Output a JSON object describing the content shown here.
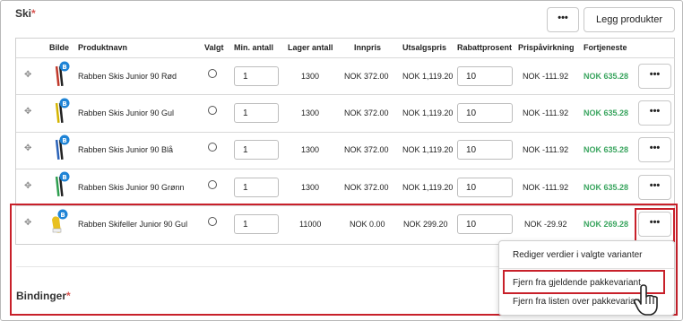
{
  "ski": {
    "title": "Ski",
    "required_mark": "*"
  },
  "bindings": {
    "title": "Bindinger",
    "required_mark": "*"
  },
  "toolbar": {
    "more_label": "•••",
    "add_products_label": "Legg produkter"
  },
  "table": {
    "headers": [
      "Bilde",
      "Produktnavn",
      "Valgt",
      "Min. antall",
      "Lager antall",
      "Innpris",
      "Utsalgspris",
      "Rabattprosent",
      "Prispåvirkning",
      "Fortjeneste"
    ],
    "rows": [
      {
        "name": "Rabben Skis Junior 90 Rød",
        "min_qty": "1",
        "stock": "1300",
        "cost": "NOK 372.00",
        "sale": "NOK 1,119.20",
        "discount": "10",
        "impact": "NOK -111.92",
        "profit": "NOK 635.28",
        "more": "•••"
      },
      {
        "name": "Rabben Skis Junior 90 Gul",
        "min_qty": "1",
        "stock": "1300",
        "cost": "NOK 372.00",
        "sale": "NOK 1,119.20",
        "discount": "10",
        "impact": "NOK -111.92",
        "profit": "NOK 635.28",
        "more": "•••"
      },
      {
        "name": "Rabben Skis Junior 90 Blå",
        "min_qty": "1",
        "stock": "1300",
        "cost": "NOK 372.00",
        "sale": "NOK 1,119.20",
        "discount": "10",
        "impact": "NOK -111.92",
        "profit": "NOK 635.28",
        "more": "•••"
      },
      {
        "name": "Rabben Skis Junior 90 Grønn",
        "min_qty": "1",
        "stock": "1300",
        "cost": "NOK 372.00",
        "sale": "NOK 1,119.20",
        "discount": "10",
        "impact": "NOK -111.92",
        "profit": "NOK 635.28",
        "more": "•••"
      },
      {
        "name": "Rabben Skifeller Junior 90 Gul",
        "min_qty": "1",
        "stock": "11000",
        "cost": "NOK 0.00",
        "sale": "NOK 299.20",
        "discount": "10",
        "impact": "NOK -29.92",
        "profit": "NOK 269.28",
        "more": "•••"
      }
    ]
  },
  "menu": {
    "items": [
      "Rediger verdier i valgte varianter",
      "Fjern fra gjeldende pakkevariant",
      "Fjern fra listen over pakkevarianter"
    ]
  },
  "colors": {
    "profit": "#3aa55f",
    "highlight": "#c8202a",
    "badge": "#1f84d6"
  }
}
